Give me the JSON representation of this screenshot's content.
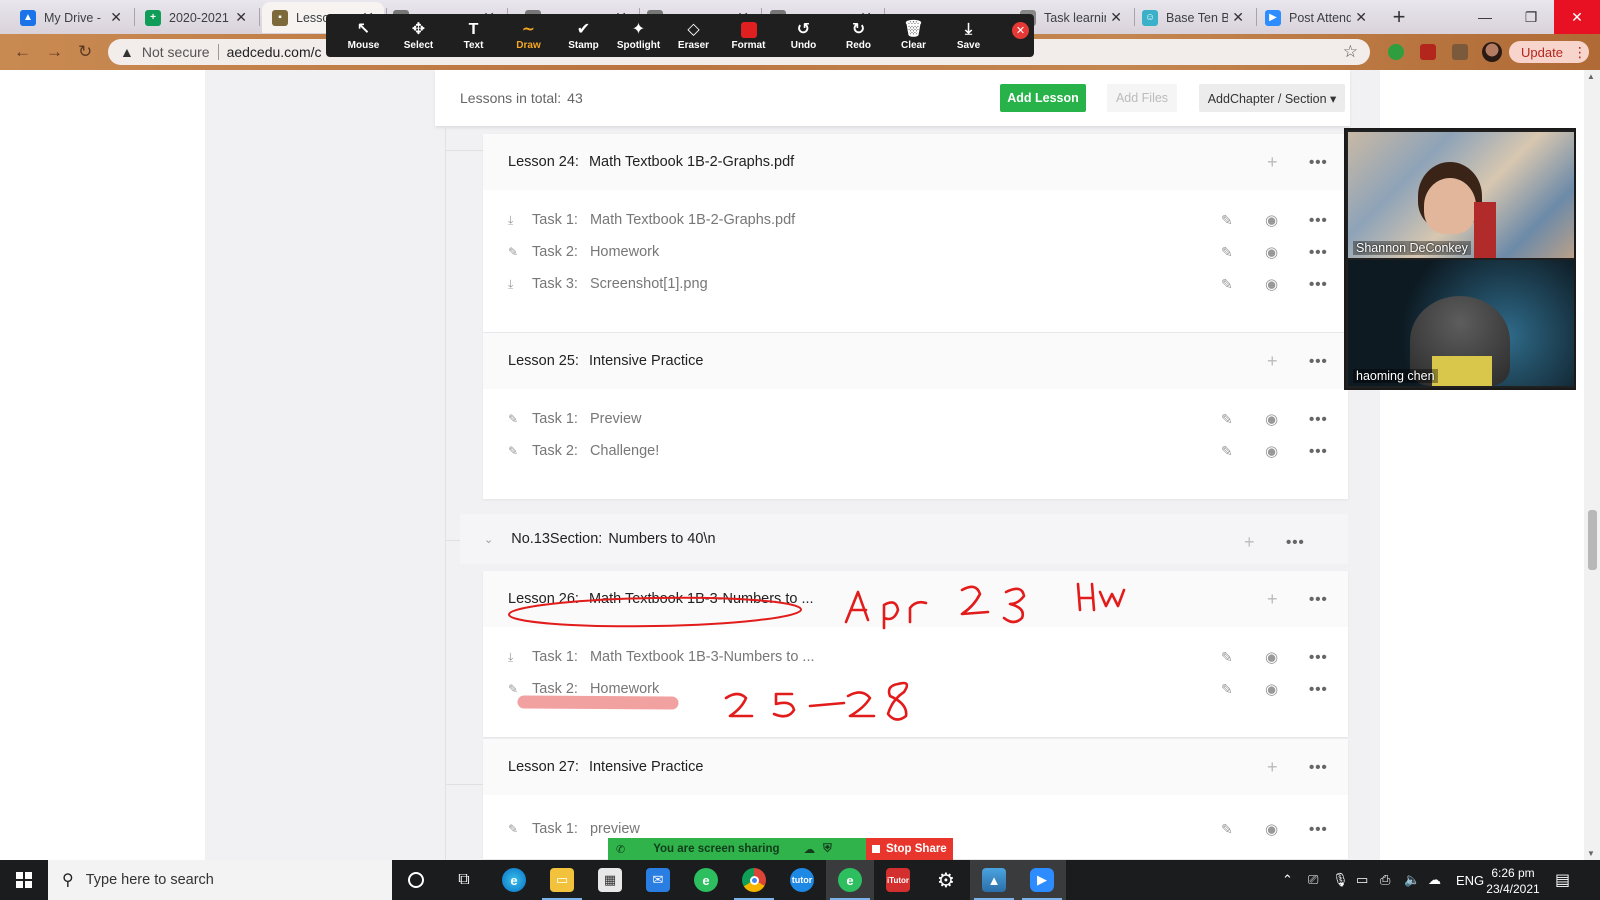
{
  "browser": {
    "tabs": [
      {
        "label": "My Drive - ",
        "color": "#1a73e8",
        "glyph": "▲"
      },
      {
        "label": "2020-2021",
        "color": "#0f9d58",
        "glyph": "+"
      },
      {
        "label": "Lesso",
        "color": "#7c6a3a",
        "glyph": "▪"
      },
      {
        "label": "",
        "color": "#777777",
        "glyph": ""
      },
      {
        "label": "",
        "color": "#777777",
        "glyph": ""
      },
      {
        "label": "",
        "color": "#777777",
        "glyph": ""
      },
      {
        "label": "",
        "color": "#777777",
        "glyph": ""
      },
      {
        "label": "Task learnin",
        "color": "#888888",
        "glyph": "▫"
      },
      {
        "label": "Base Ten Bl",
        "color": "#3bb1c9",
        "glyph": "☺"
      },
      {
        "label": "Post Attend",
        "color": "#2d8cff",
        "glyph": "▶"
      }
    ],
    "new_tab": "+",
    "address": {
      "warning": "Not secure",
      "url": "aedcedu.com/c"
    },
    "update_label": "Update"
  },
  "annotate_toolbar": {
    "tools": [
      {
        "label": "Mouse",
        "icon": "↖"
      },
      {
        "label": "Select",
        "icon": "✥"
      },
      {
        "label": "Text",
        "icon": "T"
      },
      {
        "label": "Draw",
        "icon": "∼"
      },
      {
        "label": "Stamp",
        "icon": "✔"
      },
      {
        "label": "Spotlight",
        "icon": "✦"
      },
      {
        "label": "Eraser",
        "icon": "◇"
      },
      {
        "label": "Format",
        "icon": ""
      },
      {
        "label": "Undo",
        "icon": "↺"
      },
      {
        "label": "Redo",
        "icon": "↻"
      },
      {
        "label": "Clear",
        "icon": "🗑"
      },
      {
        "label": "Save",
        "icon": "⤓"
      }
    ],
    "selected": "Draw",
    "format_color": "#e02020"
  },
  "lessons_header": {
    "total_label": "Lessons in total:",
    "total_count": "43",
    "add_lesson": "Add Lesson",
    "add_files": "Add Files",
    "add_chapter": "AddChapter / Section ▾"
  },
  "lessons": [
    {
      "number": "Lesson 24:",
      "title": "Math Textbook 1B-2-Graphs.pdf",
      "tasks": [
        {
          "num": "Task 1:",
          "title": "Math Textbook 1B-2-Graphs.pdf",
          "icon": "⤓"
        },
        {
          "num": "Task 2:",
          "title": "Homework",
          "icon": "✎"
        },
        {
          "num": "Task 3:",
          "title": "Screenshot[1].png",
          "icon": "⤓"
        }
      ]
    },
    {
      "number": "Lesson 25:",
      "title": "Intensive Practice",
      "tasks": [
        {
          "num": "Task 1:",
          "title": "Preview",
          "icon": "✎"
        },
        {
          "num": "Task 2:",
          "title": "Challenge!",
          "icon": "✎"
        }
      ]
    },
    {
      "number": "Lesson 26:",
      "title": "Math Textbook 1B-3-Numbers to ...",
      "tasks": [
        {
          "num": "Task 1:",
          "title": "Math Textbook 1B-3-Numbers to ...",
          "icon": "⤓"
        },
        {
          "num": "Task 2:",
          "title": "Homework",
          "icon": "✎"
        }
      ]
    },
    {
      "number": "Lesson 27:",
      "title": "Intensive Practice",
      "tasks": [
        {
          "num": "Task 1:",
          "title": "preview",
          "icon": "✎"
        }
      ]
    }
  ],
  "section": {
    "label": "No.13Section:",
    "title": "Numbers to 40\\n"
  },
  "video": {
    "participants": [
      "Shannon DeConkey",
      "haoming chen"
    ]
  },
  "share": {
    "status": "You are screen sharing",
    "stop": "Stop Share"
  },
  "taskbar": {
    "search_placeholder": "Type here to search",
    "language": "ENG",
    "time": "6:26 pm",
    "date": "23/4/2021"
  }
}
